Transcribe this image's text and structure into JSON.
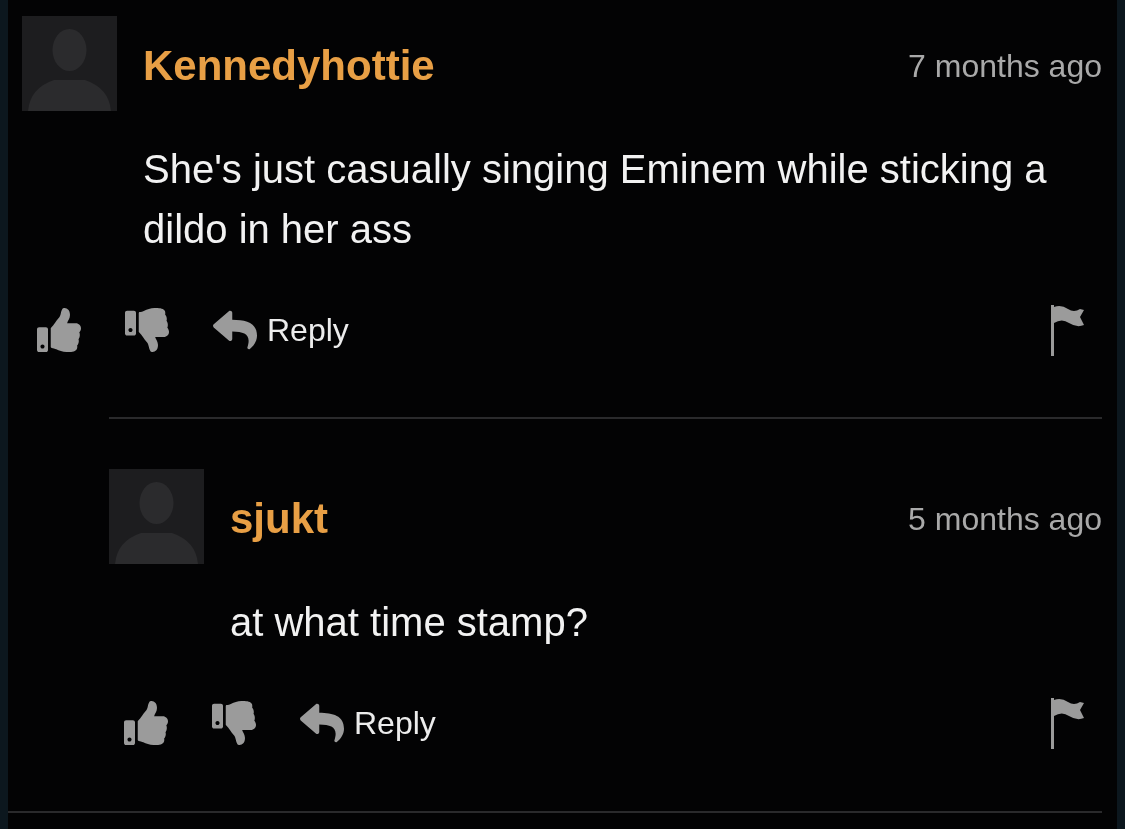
{
  "comments": [
    {
      "username": "Kennedyhottie",
      "time": "7 months ago",
      "text": "She's just casually singing Eminem while sticking a dildo in her ass",
      "reply_label": "Reply",
      "replies": [
        {
          "username": "sjukt",
          "time": "5 months ago",
          "text": "at what time stamp?",
          "reply_label": "Reply"
        }
      ]
    }
  ]
}
